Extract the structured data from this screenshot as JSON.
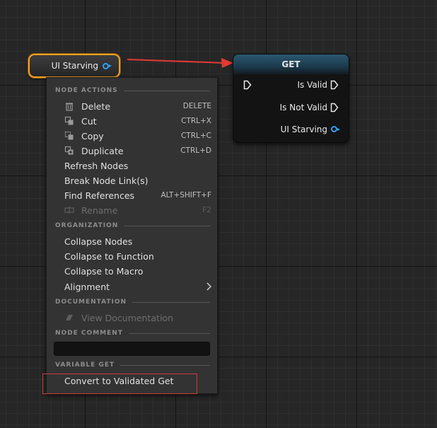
{
  "variable_node": {
    "label": "UI Starving",
    "pin_color": "#2ea0f5"
  },
  "get_node": {
    "title": "GET",
    "rows": [
      "Is Valid",
      "Is Not Valid",
      "UI Starving"
    ]
  },
  "menu": {
    "sections": {
      "node_actions": "NODE ACTIONS",
      "organization": "ORGANIZATION",
      "documentation": "DOCUMENTATION",
      "node_comment": "NODE COMMENT",
      "variable_get": "VARIABLE GET"
    },
    "items": {
      "delete": {
        "label": "Delete",
        "shortcut": "DELETE"
      },
      "cut": {
        "label": "Cut",
        "shortcut": "CTRL+X"
      },
      "copy": {
        "label": "Copy",
        "shortcut": "CTRL+C"
      },
      "duplicate": {
        "label": "Duplicate",
        "shortcut": "CTRL+D"
      },
      "refresh": {
        "label": "Refresh Nodes"
      },
      "break_links": {
        "label": "Break Node Link(s)"
      },
      "find_refs": {
        "label": "Find References",
        "shortcut": "ALT+SHIFT+F"
      },
      "rename": {
        "label": "Rename",
        "shortcut": "F2"
      },
      "collapse_nodes": {
        "label": "Collapse Nodes"
      },
      "collapse_function": {
        "label": "Collapse to Function"
      },
      "collapse_macro": {
        "label": "Collapse to Macro"
      },
      "alignment": {
        "label": "Alignment"
      },
      "view_docs": {
        "label": "View Documentation"
      },
      "convert": {
        "label": "Convert to Validated Get"
      }
    },
    "comment_value": ""
  },
  "colors": {
    "var_border": "#f5a020",
    "pin": "#2ea0f5",
    "arrow": "#e53935",
    "highlight": "#d03a3a"
  }
}
